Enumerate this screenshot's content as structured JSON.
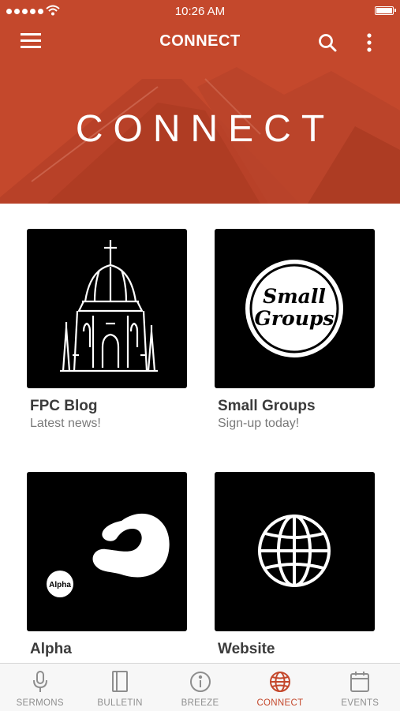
{
  "status_bar": {
    "time": "10:26 AM"
  },
  "header": {
    "title": "CONNECT"
  },
  "hero": {
    "title": "CONNECT"
  },
  "cards": [
    {
      "name": "FPC Blog",
      "subtitle": "Latest news!",
      "icon": "church-dome-icon"
    },
    {
      "name": "Small Groups",
      "subtitle": "Sign-up today!",
      "icon": "small-groups-logo",
      "logo_text_line1": "Small",
      "logo_text_line2": "Groups"
    },
    {
      "name": "Alpha",
      "subtitle": "",
      "icon": "alpha-logo",
      "logo_text": "Alpha"
    },
    {
      "name": "Website",
      "subtitle": "",
      "icon": "globe-icon"
    }
  ],
  "tabs": [
    {
      "label": "SERMONS",
      "icon": "microphone-icon",
      "active": false
    },
    {
      "label": "BULLETIN",
      "icon": "book-icon",
      "active": false
    },
    {
      "label": "BREEZE",
      "icon": "info-icon",
      "active": false
    },
    {
      "label": "CONNECT",
      "icon": "globe-icon",
      "active": true
    },
    {
      "label": "EVENTS",
      "icon": "calendar-icon",
      "active": false
    }
  ],
  "colors": {
    "brand": "#c4482c",
    "tab_inactive": "#8e8e8e"
  }
}
